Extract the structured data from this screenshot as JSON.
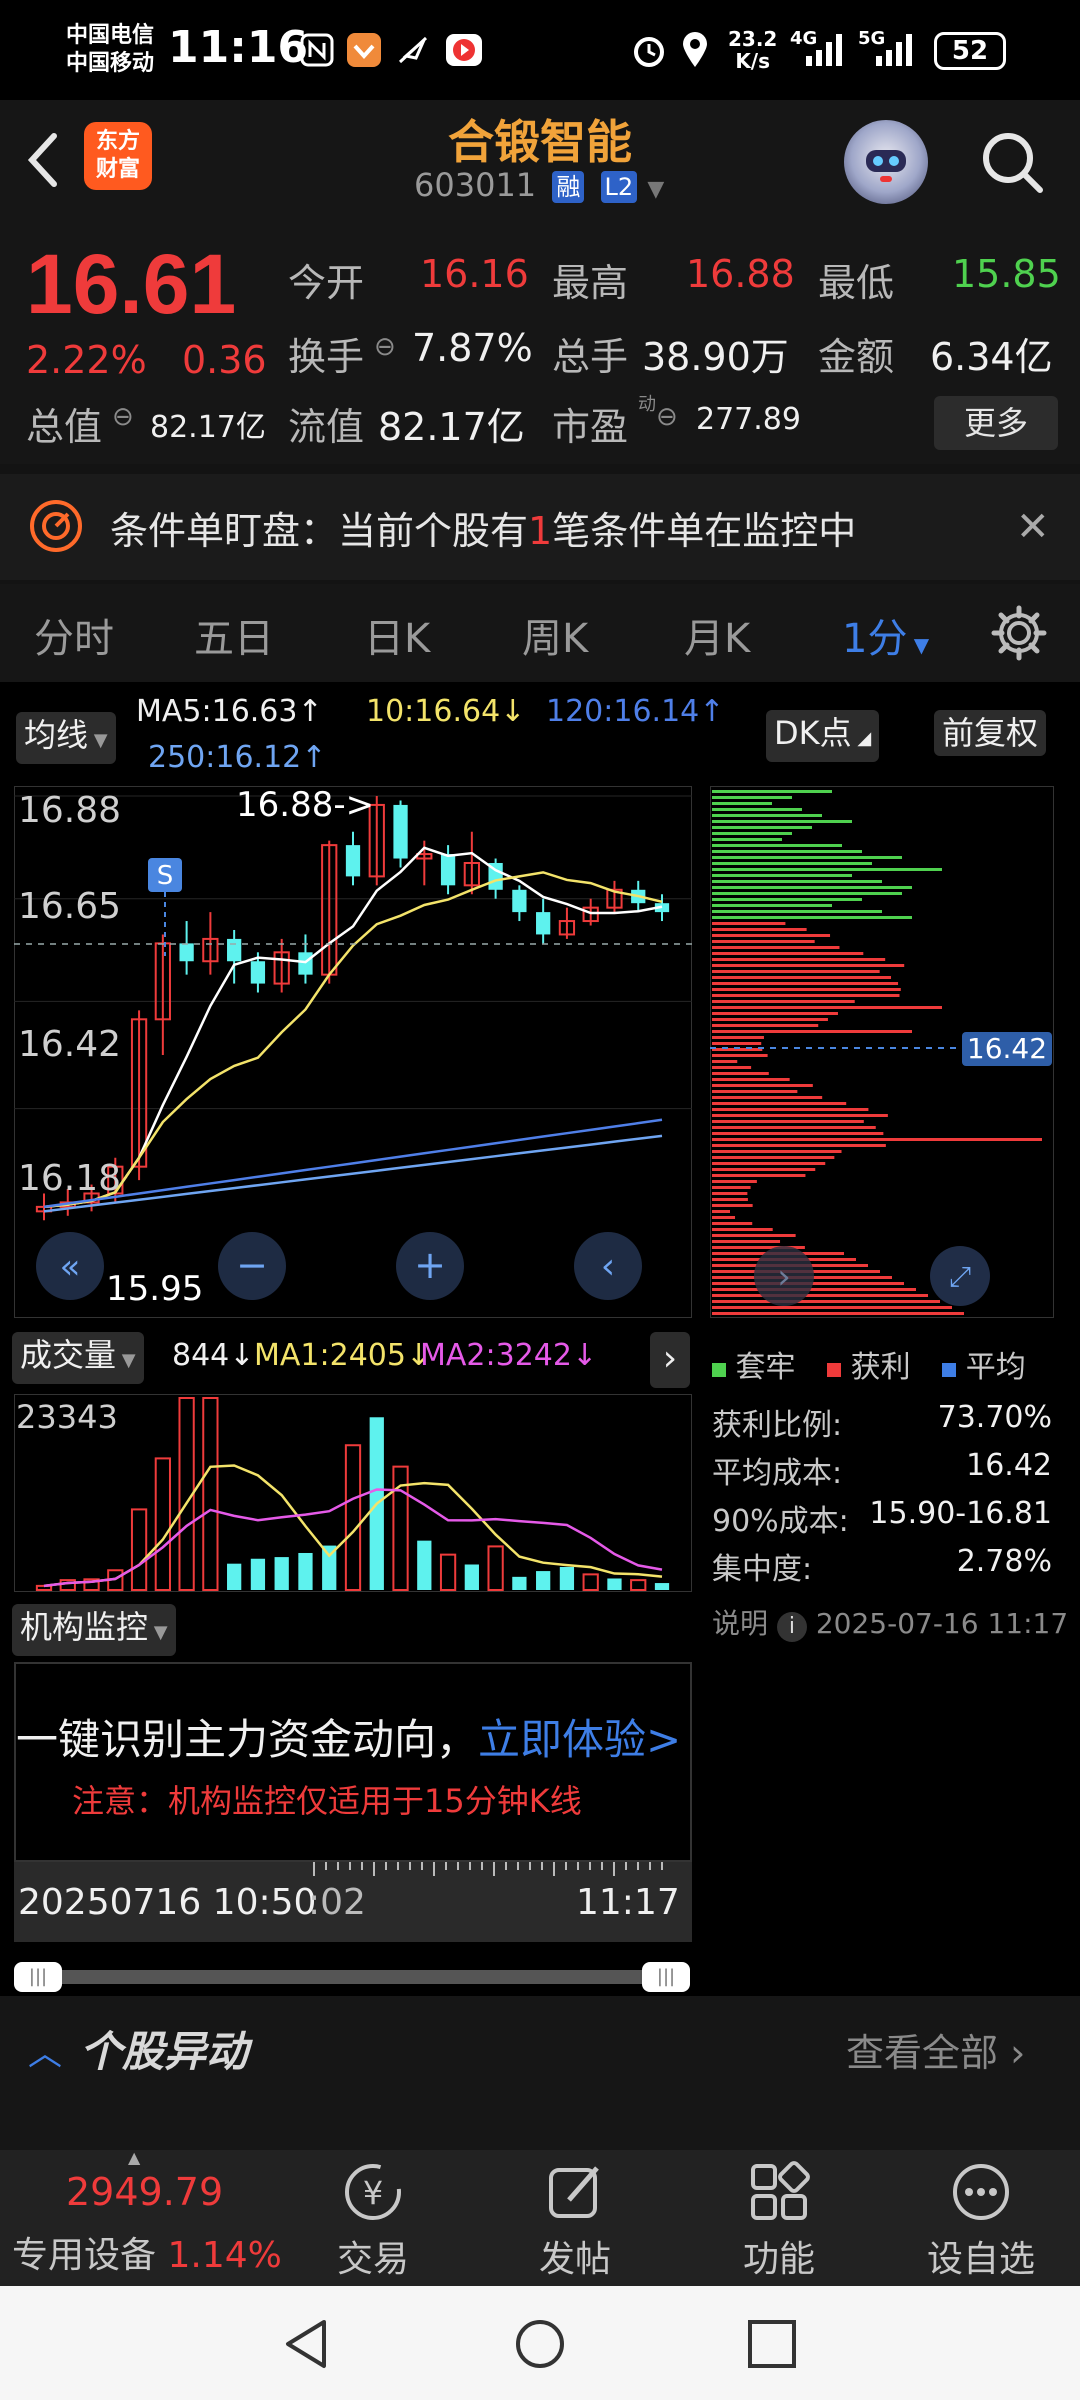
{
  "status": {
    "carrier1": "中国电信",
    "carrier2": "中国移动",
    "time": "11:16",
    "net_speed": "23.2",
    "net_unit": "K/s",
    "net4g": "4G",
    "net5g": "5G",
    "battery": "52"
  },
  "header": {
    "logo_line1": "东方",
    "logo_line2": "财富",
    "name": "合锻智能",
    "code": "603011",
    "tag1": "融",
    "tag2": "L2"
  },
  "quote": {
    "price": "16.61",
    "pct": "2.22%",
    "chg": "0.36",
    "open_label": "今开",
    "open": "16.16",
    "high_label": "最高",
    "high": "16.88",
    "low_label": "最低",
    "low": "15.85",
    "turnover_label": "换手",
    "turnover": "7.87%",
    "volume_label": "总手",
    "volume": "38.90万",
    "amount_label": "金额",
    "amount": "6.34亿",
    "mktcap_label": "总值",
    "mktcap": "82.17亿",
    "float_label": "流值",
    "float": "82.17亿",
    "pe_label": "市盈",
    "pe_sup": "动",
    "pe": "277.89",
    "more": "更多"
  },
  "condition": {
    "text_a": "条件单盯盘：当前个股有",
    "text_num": "1",
    "text_b": "笔条件单在监控中"
  },
  "tabs": [
    "分时",
    "五日",
    "日K",
    "周K",
    "月K",
    "1分"
  ],
  "chart": {
    "indicator_chip": "均线",
    "ma5": "MA5:16.63↑",
    "ma10": "10:16.64↓",
    "ma120": "120:16.14↑",
    "ma250": "250:16.12↑",
    "dk_chip": "DK点",
    "adjust_chip": "前复权",
    "y_labels": [
      "16.88",
      "16.65",
      "16.42",
      "16.18"
    ],
    "max_note": "16.88->",
    "min_note": "15.95",
    "signal": "S",
    "cost_price": "16.42",
    "vol_chip": "成交量",
    "vol": "844↓",
    "ma1": "MA1:2405↓",
    "ma2": "MA2:3242↓",
    "vol_max": "23343",
    "inst_chip": "机构监控",
    "inst_text": "一键识别主力资金动向，",
    "inst_link": "立即体验>",
    "inst_note": "注意：机构监控仅适用于15分钟K线",
    "time_start": "20250716 10:50",
    "time_mid": ":02",
    "time_end": "11:17"
  },
  "chart_data": {
    "type": "candlestick",
    "title": "",
    "ylim": [
      15.85,
      16.88
    ],
    "y_ticks": [
      16.88,
      16.65,
      16.42,
      16.18
    ],
    "candles": [
      {
        "o": 15.95,
        "h": 15.99,
        "l": 15.93,
        "c": 15.96
      },
      {
        "o": 15.96,
        "h": 16.0,
        "l": 15.94,
        "c": 15.97
      },
      {
        "o": 15.97,
        "h": 16.01,
        "l": 15.95,
        "c": 15.99
      },
      {
        "o": 15.99,
        "h": 16.07,
        "l": 15.97,
        "c": 16.05
      },
      {
        "o": 16.05,
        "h": 16.4,
        "l": 16.02,
        "c": 16.38
      },
      {
        "o": 16.38,
        "h": 16.57,
        "l": 16.3,
        "c": 16.55
      },
      {
        "o": 16.55,
        "h": 16.6,
        "l": 16.48,
        "c": 16.51
      },
      {
        "o": 16.51,
        "h": 16.62,
        "l": 16.48,
        "c": 16.56
      },
      {
        "o": 16.56,
        "h": 16.58,
        "l": 16.46,
        "c": 16.51
      },
      {
        "o": 16.51,
        "h": 16.53,
        "l": 16.44,
        "c": 16.46
      },
      {
        "o": 16.46,
        "h": 16.56,
        "l": 16.44,
        "c": 16.53
      },
      {
        "o": 16.53,
        "h": 16.57,
        "l": 16.46,
        "c": 16.48
      },
      {
        "o": 16.48,
        "h": 16.78,
        "l": 16.46,
        "c": 16.77
      },
      {
        "o": 16.77,
        "h": 16.8,
        "l": 16.68,
        "c": 16.7
      },
      {
        "o": 16.7,
        "h": 16.88,
        "l": 16.68,
        "c": 16.86
      },
      {
        "o": 16.86,
        "h": 16.87,
        "l": 16.72,
        "c": 16.74
      },
      {
        "o": 16.74,
        "h": 16.78,
        "l": 16.68,
        "c": 16.75
      },
      {
        "o": 16.75,
        "h": 16.77,
        "l": 16.66,
        "c": 16.68
      },
      {
        "o": 16.68,
        "h": 16.8,
        "l": 16.66,
        "c": 16.73
      },
      {
        "o": 16.73,
        "h": 16.74,
        "l": 16.65,
        "c": 16.67
      },
      {
        "o": 16.67,
        "h": 16.68,
        "l": 16.6,
        "c": 16.62
      },
      {
        "o": 16.62,
        "h": 16.65,
        "l": 16.55,
        "c": 16.57
      },
      {
        "o": 16.57,
        "h": 16.63,
        "l": 16.56,
        "c": 16.6
      },
      {
        "o": 16.6,
        "h": 16.65,
        "l": 16.59,
        "c": 16.63
      },
      {
        "o": 16.63,
        "h": 16.69,
        "l": 16.62,
        "c": 16.67
      },
      {
        "o": 16.67,
        "h": 16.69,
        "l": 16.62,
        "c": 16.64
      },
      {
        "o": 16.64,
        "h": 16.66,
        "l": 16.6,
        "c": 16.62
      }
    ],
    "volume": [
      500,
      1200,
      1300,
      2400,
      9800,
      16000,
      23343,
      23343,
      3200,
      3800,
      4000,
      4500,
      5400,
      17600,
      21000,
      15000,
      6000,
      4300,
      3100,
      5300,
      1600,
      2300,
      2800,
      1900,
      1400,
      1200,
      844
    ],
    "volume_colors": [
      "red",
      "red",
      "red",
      "red",
      "red",
      "red",
      "red",
      "red",
      "cyan",
      "cyan",
      "cyan",
      "cyan",
      "cyan",
      "red",
      "cyan",
      "red",
      "cyan",
      "red",
      "cyan",
      "red",
      "cyan",
      "cyan",
      "cyan",
      "red",
      "cyan",
      "red",
      "cyan"
    ],
    "vol_ymax": 23343,
    "right_panel": {
      "legend": [
        "套牢",
        "获利",
        "平均"
      ],
      "profit_ratio_label": "获利比例:",
      "profit_ratio": "73.70%",
      "avg_cost_label": "平均成本:",
      "avg_cost": "16.42",
      "cost90_label": "90%成本:",
      "cost90": "15.90-16.81",
      "concentration_label": "集中度:",
      "concentration": "2.78%",
      "note_label": "说明",
      "note_time": "2025-07-16 11:17"
    }
  },
  "movers": {
    "title": "个股异动",
    "view_all": "查看全部"
  },
  "bottom_nav": {
    "index_value": "2949.79",
    "sector": "专用设备",
    "sector_pct": "1.14%",
    "trade": "交易",
    "post": "发帖",
    "features": "功能",
    "watch": "设自选"
  },
  "colors": {
    "up": "#ef3b3b",
    "down": "#4fd14f",
    "accent": "#3e7ee6",
    "brand": "#ff5a1f",
    "name": "#f1a33a"
  }
}
